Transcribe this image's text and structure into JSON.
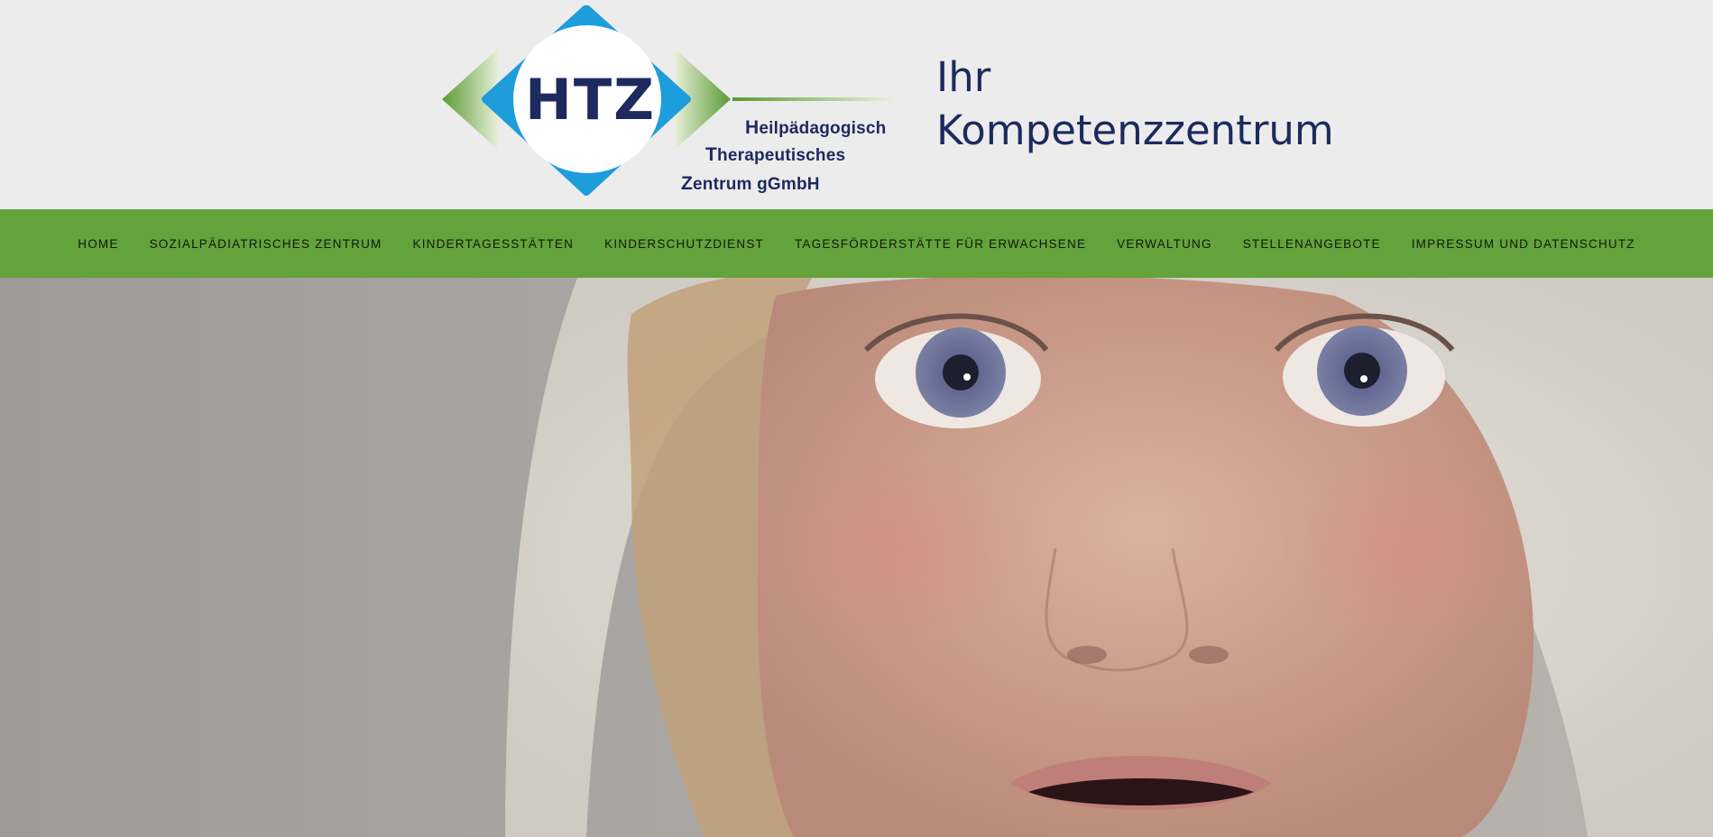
{
  "logo": {
    "acronym": "HTZ",
    "line1_initial": "H",
    "line1_rest": "eilpädagogisch",
    "line2_initial": "T",
    "line2_rest": "herapeutisches",
    "line3_initial": "Z",
    "line3_rest": "entrum gGmbH",
    "colors": {
      "blue": "#1e9ddd",
      "navy": "#1c2a5e",
      "green": "#64a23b"
    }
  },
  "tagline": {
    "line1": "Ihr",
    "line2": "Kompetenzzentrum"
  },
  "nav": {
    "background": "#64a23b",
    "items": [
      {
        "label": "HOME"
      },
      {
        "label": "SOZIALPÄDIATRISCHES ZENTRUM"
      },
      {
        "label": "KINDERTAGESSTÄTTEN"
      },
      {
        "label": "KINDERSCHUTZDIENST"
      },
      {
        "label": "TAGESFÖRDERSTÄTTE FÜR ERWACHSENE"
      },
      {
        "label": "VERWALTUNG"
      },
      {
        "label": "STELLENANGEBOTE"
      },
      {
        "label": "IMPRESSUM UND DATENSCHUTZ"
      }
    ]
  },
  "hero": {
    "image": "child-in-hood-photo"
  }
}
